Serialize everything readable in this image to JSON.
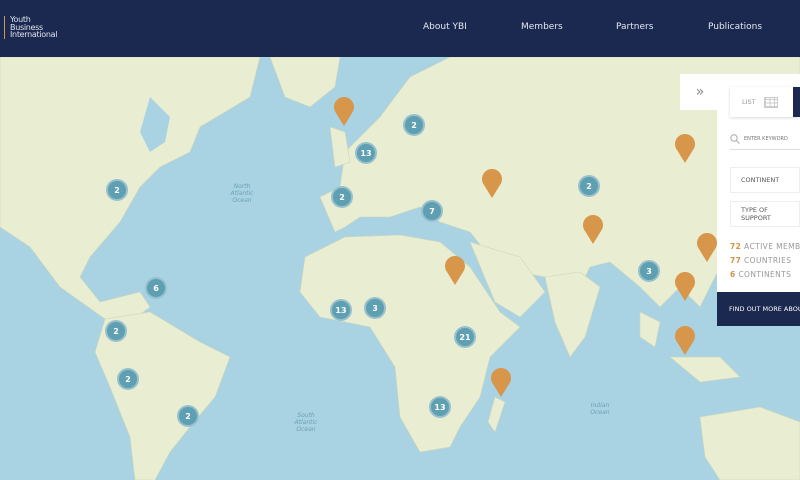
{
  "header": {
    "logo_lines": [
      "Youth",
      "Business",
      "International"
    ],
    "nav": [
      "About YBI",
      "Members",
      "Partners",
      "Publications"
    ]
  },
  "map": {
    "ocean_labels": [
      "North Atlantic Ocean",
      "South Atlantic Ocean",
      "Indian Ocean"
    ],
    "clusters": [
      {
        "count": "2",
        "place": "North America east"
      },
      {
        "count": "2",
        "place": "Northern Europe"
      },
      {
        "count": "13",
        "place": "Western Europe"
      },
      {
        "count": "2",
        "place": "Iberia"
      },
      {
        "count": "7",
        "place": "Eastern Mediterranean"
      },
      {
        "count": "2",
        "place": "Central Asia"
      },
      {
        "count": "6",
        "place": "Caribbean"
      },
      {
        "count": "2",
        "place": "Northern South America"
      },
      {
        "count": "13",
        "place": "West Africa"
      },
      {
        "count": "3",
        "place": "Central West Africa"
      },
      {
        "count": "21",
        "place": "East Africa"
      },
      {
        "count": "2",
        "place": "Peru"
      },
      {
        "count": "2",
        "place": "Southern South America"
      },
      {
        "count": "13",
        "place": "Southern Africa"
      },
      {
        "count": "3",
        "place": "Southeast Asia"
      }
    ],
    "pin_color": "#d8964a",
    "cluster_color": "#5f9fb2"
  },
  "panel": {
    "list_label": "LIST",
    "search_placeholder": "ENTER KEYWORD",
    "continent_label": "CONTINENT",
    "support_label": "TYPE OF SUPPORT",
    "stats": [
      {
        "num": "72",
        "label": "ACTIVE MEMBERS"
      },
      {
        "num": "77",
        "label": "COUNTRIES"
      },
      {
        "num": "6",
        "label": "CONTINENTS"
      }
    ],
    "cta": "FIND OUT MORE ABOUT"
  }
}
